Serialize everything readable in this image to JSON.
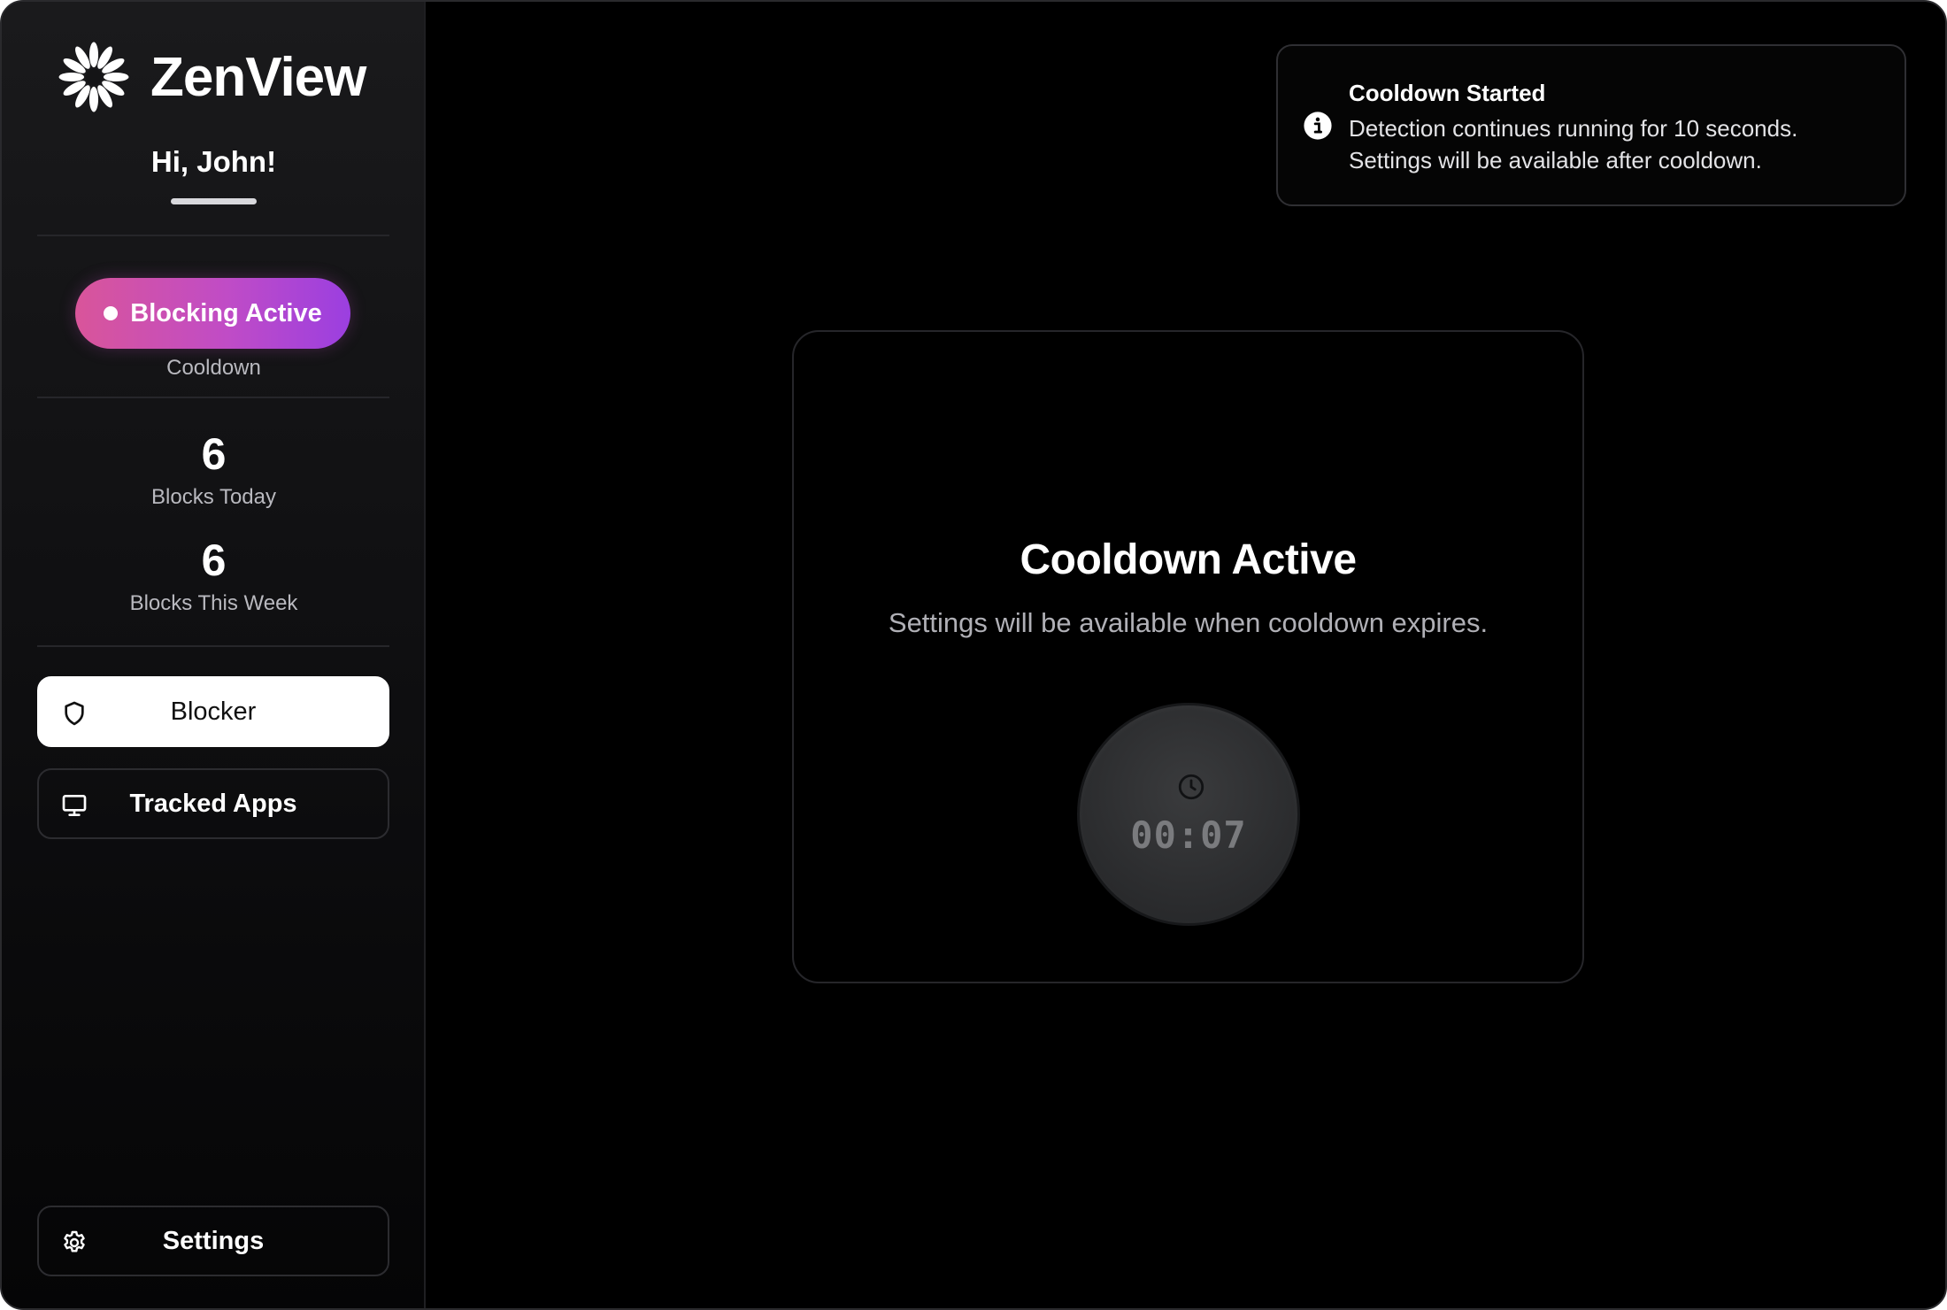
{
  "app": {
    "name": "ZenView",
    "greeting": "Hi, John!"
  },
  "status": {
    "label": "Blocking Active",
    "sublabel": "Cooldown",
    "gradient": [
      "#d9559a",
      "#9b3fe0"
    ]
  },
  "stats": [
    {
      "value": "6",
      "label": "Blocks Today"
    },
    {
      "value": "6",
      "label": "Blocks This Week"
    }
  ],
  "nav": {
    "items": [
      {
        "label": "Blocker",
        "icon": "shield-icon",
        "active": true
      },
      {
        "label": "Tracked Apps",
        "icon": "monitor-icon",
        "active": false
      }
    ],
    "settings": {
      "label": "Settings",
      "icon": "gear-icon"
    }
  },
  "toast": {
    "icon": "info-icon",
    "title": "Cooldown Started",
    "lines": [
      "Detection continues running for 10 seconds.",
      "Settings will be available after cooldown."
    ]
  },
  "cooldown": {
    "title": "Cooldown Active",
    "subtitle": "Settings will be available when cooldown expires.",
    "icon": "clock-icon",
    "timer": "00:07"
  }
}
